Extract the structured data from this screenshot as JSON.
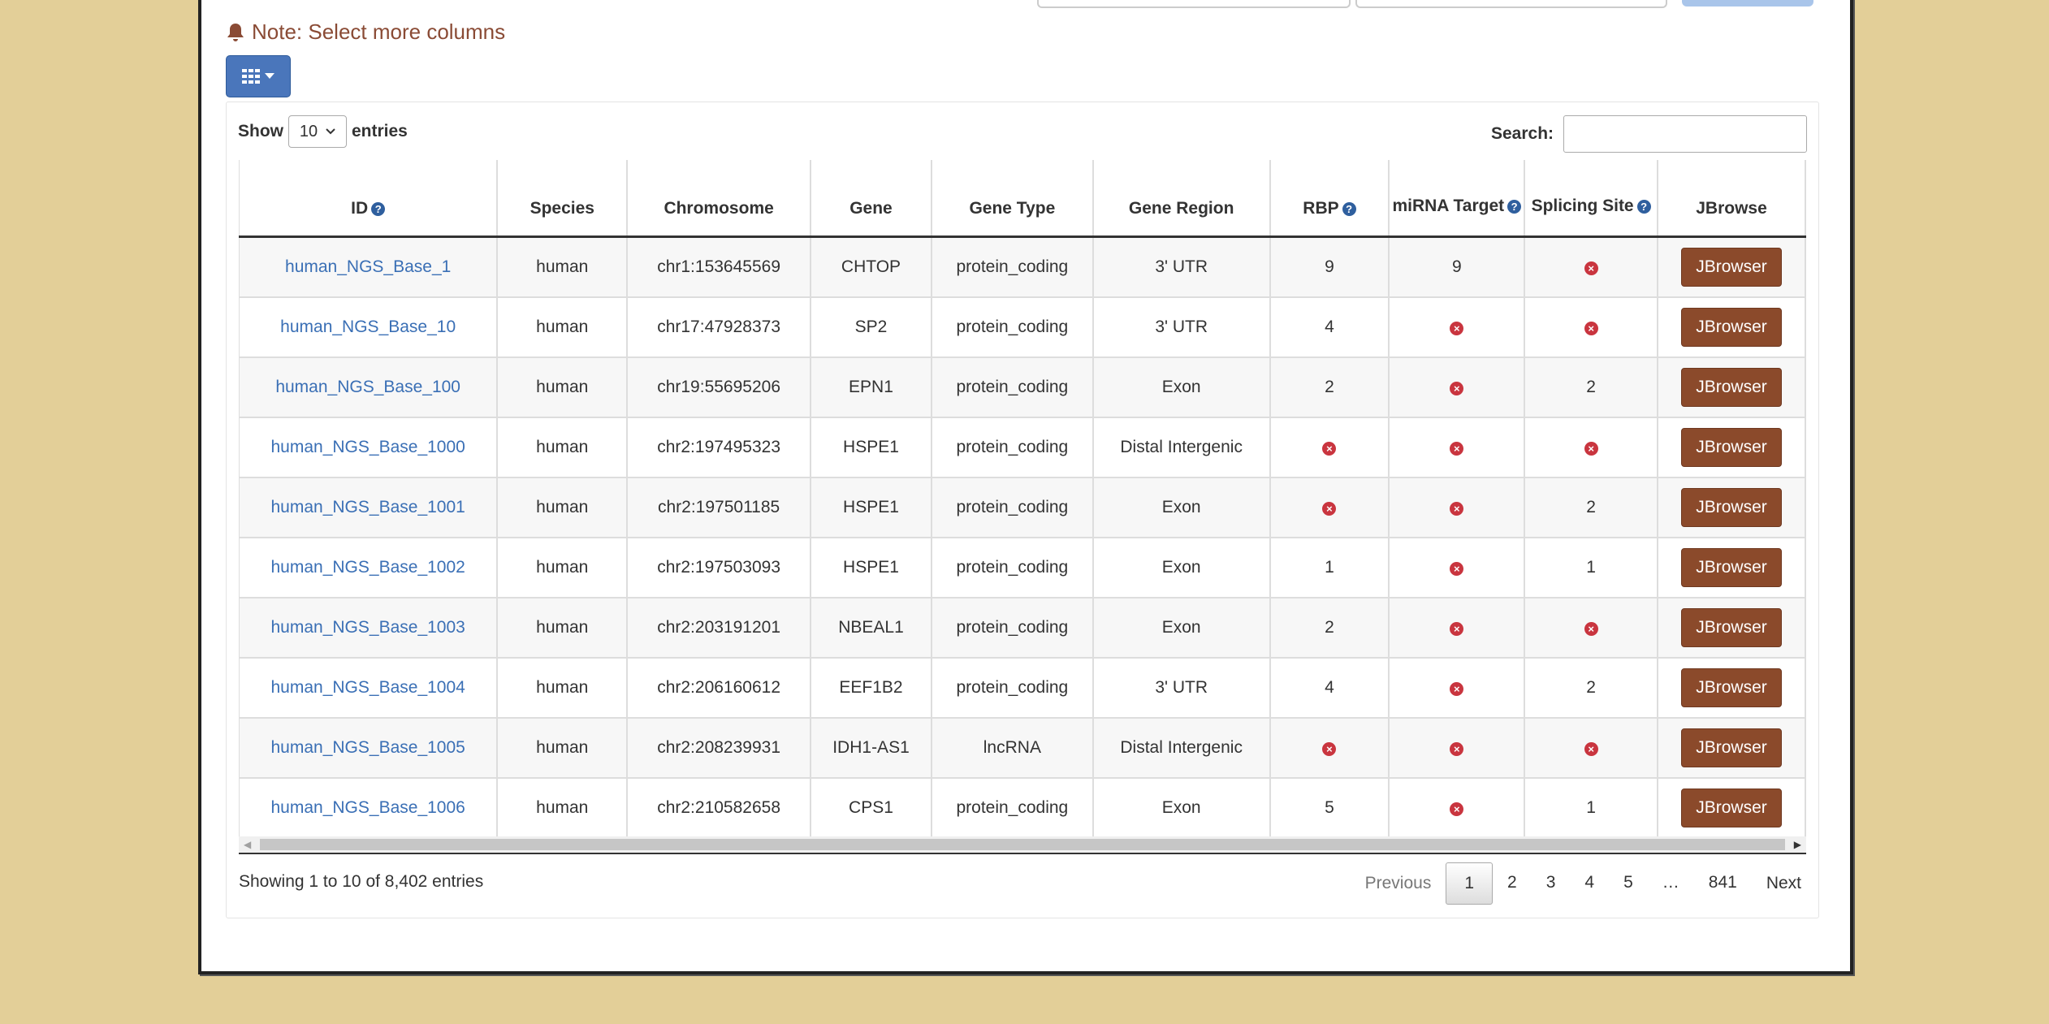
{
  "note": "Note: Select more columns",
  "length": {
    "prefix": "Show",
    "value": "10",
    "suffix": "entries"
  },
  "search": {
    "label": "Search:",
    "value": ""
  },
  "columns": [
    {
      "label": "ID",
      "help": true
    },
    {
      "label": "Species"
    },
    {
      "label": "Chromosome"
    },
    {
      "label": "Gene"
    },
    {
      "label": "Gene Type"
    },
    {
      "label": "Gene Region"
    },
    {
      "label": "RBP",
      "help": true
    },
    {
      "label": "miRNA Target",
      "help": true
    },
    {
      "label": "Splicing Site",
      "help": true
    },
    {
      "label": "JBrowse"
    }
  ],
  "rows": [
    {
      "id": "human_NGS_Base_1",
      "species": "human",
      "chromosome": "chr1:153645569",
      "gene": "CHTOP",
      "gene_type": "protein_coding",
      "gene_region": "3' UTR",
      "rbp": "9",
      "mirna": "9",
      "splicing": null
    },
    {
      "id": "human_NGS_Base_10",
      "species": "human",
      "chromosome": "chr17:47928373",
      "gene": "SP2",
      "gene_type": "protein_coding",
      "gene_region": "3' UTR",
      "rbp": "4",
      "mirna": null,
      "splicing": null
    },
    {
      "id": "human_NGS_Base_100",
      "species": "human",
      "chromosome": "chr19:55695206",
      "gene": "EPN1",
      "gene_type": "protein_coding",
      "gene_region": "Exon",
      "rbp": "2",
      "mirna": null,
      "splicing": "2"
    },
    {
      "id": "human_NGS_Base_1000",
      "species": "human",
      "chromosome": "chr2:197495323",
      "gene": "HSPE1",
      "gene_type": "protein_coding",
      "gene_region": "Distal Intergenic",
      "rbp": null,
      "mirna": null,
      "splicing": null
    },
    {
      "id": "human_NGS_Base_1001",
      "species": "human",
      "chromosome": "chr2:197501185",
      "gene": "HSPE1",
      "gene_type": "protein_coding",
      "gene_region": "Exon",
      "rbp": null,
      "mirna": null,
      "splicing": "2"
    },
    {
      "id": "human_NGS_Base_1002",
      "species": "human",
      "chromosome": "chr2:197503093",
      "gene": "HSPE1",
      "gene_type": "protein_coding",
      "gene_region": "Exon",
      "rbp": "1",
      "mirna": null,
      "splicing": "1"
    },
    {
      "id": "human_NGS_Base_1003",
      "species": "human",
      "chromosome": "chr2:203191201",
      "gene": "NBEAL1",
      "gene_type": "protein_coding",
      "gene_region": "Exon",
      "rbp": "2",
      "mirna": null,
      "splicing": null
    },
    {
      "id": "human_NGS_Base_1004",
      "species": "human",
      "chromosome": "chr2:206160612",
      "gene": "EEF1B2",
      "gene_type": "protein_coding",
      "gene_region": "3' UTR",
      "rbp": "4",
      "mirna": null,
      "splicing": "2"
    },
    {
      "id": "human_NGS_Base_1005",
      "species": "human",
      "chromosome": "chr2:208239931",
      "gene": "IDH1-AS1",
      "gene_type": "lncRNA",
      "gene_region": "Distal Intergenic",
      "rbp": null,
      "mirna": null,
      "splicing": null
    },
    {
      "id": "human_NGS_Base_1006",
      "species": "human",
      "chromosome": "chr2:210582658",
      "gene": "CPS1",
      "gene_type": "protein_coding",
      "gene_region": "Exon",
      "rbp": "5",
      "mirna": null,
      "splicing": "1"
    }
  ],
  "jbrowse_label": "JBrowser",
  "info": "Showing 1 to 10 of 8,402 entries",
  "pagination": {
    "previous": "Previous",
    "pages": [
      "1",
      "2",
      "3",
      "4",
      "5",
      "…",
      "841"
    ],
    "current": "1",
    "next": "Next"
  },
  "icons": {
    "note": "bell-icon",
    "colvis": "grid-icon",
    "help": "question-circle-icon",
    "missing": "times-circle-icon"
  },
  "colors": {
    "background": "#e3cf98",
    "note": "#8a4b35",
    "link": "#3a6fb5",
    "button_primary": "#4a76bb",
    "jbrowse_button": "#8b4a2b",
    "missing": "#c9353f"
  }
}
